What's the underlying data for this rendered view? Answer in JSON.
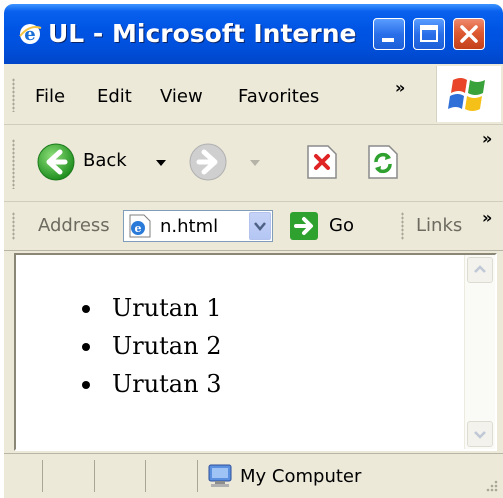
{
  "window": {
    "title": "UL - Microsoft Interne..."
  },
  "menubar": {
    "items": [
      "File",
      "Edit",
      "View",
      "Favorites"
    ],
    "overflow": "»"
  },
  "toolbar": {
    "back_label": "Back",
    "overflow": "»"
  },
  "addressbar": {
    "label": "Address",
    "url": "n.html",
    "go_label": "Go",
    "links_label": "Links",
    "overflow": "»"
  },
  "content": {
    "list_items": [
      "Urutan 1",
      "Urutan 2",
      "Urutan 3"
    ]
  },
  "statusbar": {
    "zone": "My Computer"
  },
  "colors": {
    "titlebar": "#0055e5",
    "close_button": "#de5a32",
    "chrome": "#ece9d8",
    "go_arrow": "#2ea12e"
  },
  "icons": [
    "ie-icon",
    "minimize-icon",
    "maximize-icon",
    "close-icon",
    "windows-logo-icon",
    "back-arrow-icon",
    "forward-arrow-icon",
    "stop-icon",
    "refresh-icon",
    "page-icon",
    "dropdown-arrow-icon",
    "go-arrow-icon",
    "scroll-up-icon",
    "scroll-down-icon",
    "my-computer-icon",
    "resize-grip-icon"
  ]
}
